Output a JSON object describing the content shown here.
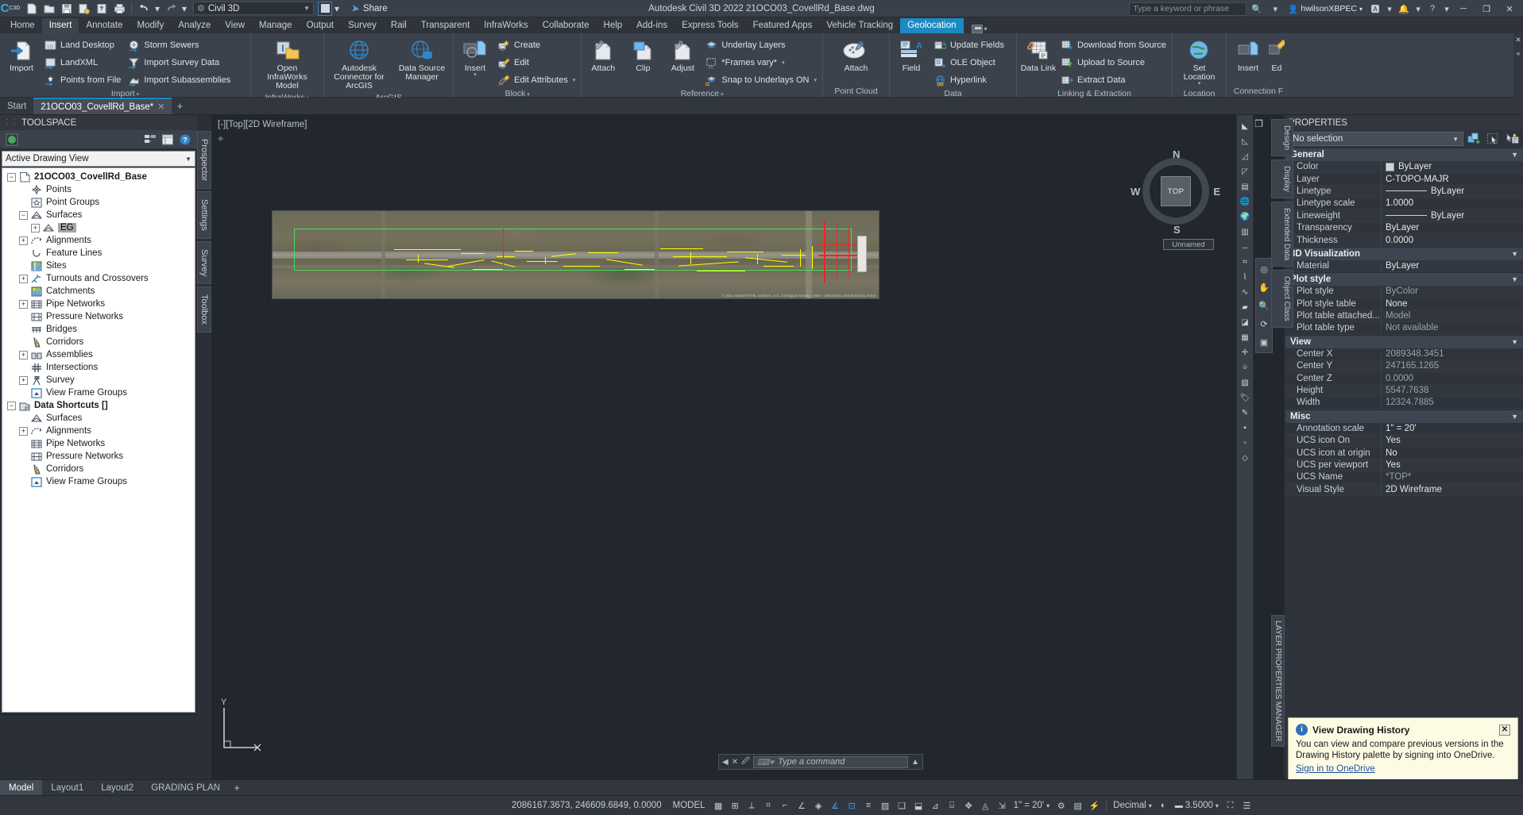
{
  "titlebar": {
    "workspace": "Civil 3D",
    "share_label": "Share",
    "title": "Autodesk Civil 3D 2022    21OCO03_CovellRd_Base.dwg",
    "search_placeholder": "Type a keyword or phrase",
    "user": "hwilsonXBPEC",
    "qat": [
      {
        "name": "new-icon",
        "glyph": "▢"
      },
      {
        "name": "open-icon",
        "glyph": "▱"
      },
      {
        "name": "save-icon",
        "glyph": "▣"
      },
      {
        "name": "saveas-icon",
        "glyph": "▤"
      },
      {
        "name": "cloud-save-icon",
        "glyph": "▥"
      },
      {
        "name": "plot-icon",
        "glyph": "⎙"
      },
      {
        "name": "undo-icon",
        "glyph": "←"
      },
      {
        "name": "redo-icon",
        "glyph": "→"
      }
    ],
    "window_buttons": [
      "─",
      "❐",
      "✕"
    ]
  },
  "ribbon_tabs": [
    {
      "label": "Home",
      "state": ""
    },
    {
      "label": "Insert",
      "state": "active"
    },
    {
      "label": "Annotate",
      "state": ""
    },
    {
      "label": "Modify",
      "state": ""
    },
    {
      "label": "Analyze",
      "state": ""
    },
    {
      "label": "View",
      "state": ""
    },
    {
      "label": "Manage",
      "state": ""
    },
    {
      "label": "Output",
      "state": ""
    },
    {
      "label": "Survey",
      "state": ""
    },
    {
      "label": "Rail",
      "state": ""
    },
    {
      "label": "Transparent",
      "state": ""
    },
    {
      "label": "InfraWorks",
      "state": ""
    },
    {
      "label": "Collaborate",
      "state": ""
    },
    {
      "label": "Help",
      "state": ""
    },
    {
      "label": "Add-ins",
      "state": ""
    },
    {
      "label": "Express Tools",
      "state": ""
    },
    {
      "label": "Featured Apps",
      "state": ""
    },
    {
      "label": "Vehicle Tracking",
      "state": ""
    },
    {
      "label": "Geolocation",
      "state": "hl"
    }
  ],
  "ribbon": {
    "panels": [
      {
        "title": "Import",
        "has_arrow": true,
        "big": [
          {
            "label": "Import",
            "name": "import-button",
            "split": true
          }
        ],
        "small": [
          {
            "label": "Land Desktop",
            "name": "land-desktop-button"
          },
          {
            "label": "LandXML",
            "name": "landxml-button"
          },
          {
            "label": "Points from File",
            "name": "points-from-file-button"
          }
        ],
        "small2": [
          {
            "label": "Storm Sewers",
            "name": "storm-sewers-button"
          },
          {
            "label": "Import Survey Data",
            "name": "import-survey-data-button"
          },
          {
            "label": "Import Subassemblies",
            "name": "import-subassemblies-button"
          }
        ]
      },
      {
        "title": "InfraWorks",
        "has_arrow": true,
        "big": [
          {
            "label": "Open InfraWorks Model",
            "name": "open-infraworks-model-button"
          }
        ]
      },
      {
        "title": "ArcGIS",
        "has_arrow": false,
        "big": [
          {
            "label": "Autodesk Connector for ArcGIS",
            "name": "autodesk-connector-arcgis-button"
          },
          {
            "label": "Data Source Manager",
            "name": "data-source-manager-button"
          }
        ]
      },
      {
        "title": "Block",
        "has_arrow": true,
        "big": [
          {
            "label": "Insert",
            "name": "insert-block-button",
            "split": true
          }
        ],
        "small": [
          {
            "label": "Create",
            "name": "create-block-button"
          },
          {
            "label": "Edit",
            "name": "edit-block-button"
          },
          {
            "label": "Edit Attributes",
            "name": "edit-attributes-button",
            "dropdown": true
          }
        ]
      },
      {
        "title": "Reference",
        "has_arrow": true,
        "big": [
          {
            "label": "Attach",
            "name": "attach-reference-button"
          },
          {
            "label": "Clip",
            "name": "clip-button"
          },
          {
            "label": "Adjust",
            "name": "adjust-button"
          }
        ],
        "small": [
          {
            "label": "Underlay Layers",
            "name": "underlay-layers-button"
          },
          {
            "label": "*Frames vary*",
            "name": "frames-vary-button",
            "dropdown": true
          },
          {
            "label": "Snap to Underlays ON",
            "name": "snap-to-underlays-button",
            "dropdown": true
          }
        ]
      },
      {
        "title": "Point Cloud",
        "has_arrow": false,
        "big": [
          {
            "label": "Attach",
            "name": "attach-point-cloud-button"
          }
        ]
      },
      {
        "title": "Data",
        "has_arrow": false,
        "big": [
          {
            "label": "Field",
            "name": "field-button"
          }
        ],
        "small": [
          {
            "label": "Update Fields",
            "name": "update-fields-button"
          },
          {
            "label": "OLE Object",
            "name": "ole-object-button"
          },
          {
            "label": "Hyperlink",
            "name": "hyperlink-button"
          }
        ]
      },
      {
        "title": "Linking & Extraction",
        "has_arrow": false,
        "big": [
          {
            "label": "Data Link",
            "name": "data-link-button"
          }
        ],
        "small": [
          {
            "label": "Download from Source",
            "name": "download-from-source-button"
          },
          {
            "label": "Upload to Source",
            "name": "upload-to-source-button"
          },
          {
            "label": "Extract  Data",
            "name": "extract-data-button"
          }
        ]
      },
      {
        "title": "Location",
        "has_arrow": false,
        "big": [
          {
            "label": "Set Location",
            "name": "set-location-button",
            "split": true
          }
        ]
      },
      {
        "title": "Connection F",
        "has_arrow": false,
        "big": [
          {
            "label": "Insert",
            "name": "insert-connection-button"
          },
          {
            "label": "Ed",
            "name": "edit-connection-button"
          }
        ]
      }
    ]
  },
  "file_tabs": {
    "start": "Start",
    "documents": [
      {
        "label": "21OCO03_CovellRd_Base*",
        "close": "✕"
      }
    ],
    "add": "+"
  },
  "toolspace": {
    "title": "TOOLSPACE",
    "view_selector": "Active Drawing View",
    "vertical_tabs": [
      "Prospector",
      "Settings",
      "Survey",
      "Toolbox"
    ],
    "tree": [
      {
        "label": "21OCO03_CovellRd_Base",
        "depth": 0,
        "expander": "−",
        "icon": "drawing-icon",
        "bold": true
      },
      {
        "label": "Points",
        "depth": 1,
        "expander": "",
        "icon": "points-icon"
      },
      {
        "label": "Point Groups",
        "depth": 1,
        "expander": "",
        "icon": "point-groups-icon"
      },
      {
        "label": "Surfaces",
        "depth": 1,
        "expander": "−",
        "icon": "surfaces-icon"
      },
      {
        "label": "EG",
        "depth": 2,
        "expander": "+",
        "icon": "surface-icon",
        "selected": true
      },
      {
        "label": "Alignments",
        "depth": 1,
        "expander": "+",
        "icon": "alignments-icon"
      },
      {
        "label": "Feature Lines",
        "depth": 1,
        "expander": "",
        "icon": "feature-lines-icon"
      },
      {
        "label": "Sites",
        "depth": 1,
        "expander": "",
        "icon": "sites-icon"
      },
      {
        "label": "Turnouts and Crossovers",
        "depth": 1,
        "expander": "+",
        "icon": "turnouts-icon"
      },
      {
        "label": "Catchments",
        "depth": 1,
        "expander": "",
        "icon": "catchments-icon"
      },
      {
        "label": "Pipe Networks",
        "depth": 1,
        "expander": "+",
        "icon": "pipe-networks-icon"
      },
      {
        "label": "Pressure Networks",
        "depth": 1,
        "expander": "",
        "icon": "pressure-networks-icon"
      },
      {
        "label": "Bridges",
        "depth": 1,
        "expander": "",
        "icon": "bridges-icon"
      },
      {
        "label": "Corridors",
        "depth": 1,
        "expander": "",
        "icon": "corridors-icon"
      },
      {
        "label": "Assemblies",
        "depth": 1,
        "expander": "+",
        "icon": "assemblies-icon"
      },
      {
        "label": "Intersections",
        "depth": 1,
        "expander": "",
        "icon": "intersections-icon"
      },
      {
        "label": "Survey",
        "depth": 1,
        "expander": "+",
        "icon": "survey-icon"
      },
      {
        "label": "View Frame Groups",
        "depth": 1,
        "expander": "",
        "icon": "view-frame-groups-icon"
      },
      {
        "label": "Data Shortcuts []",
        "depth": 0,
        "expander": "−",
        "icon": "data-shortcuts-icon"
      },
      {
        "label": "Surfaces",
        "depth": 1,
        "expander": "",
        "icon": "surfaces-icon"
      },
      {
        "label": "Alignments",
        "depth": 1,
        "expander": "+",
        "icon": "alignments-icon"
      },
      {
        "label": "Pipe Networks",
        "depth": 1,
        "expander": "",
        "icon": "pipe-networks-icon"
      },
      {
        "label": "Pressure Networks",
        "depth": 1,
        "expander": "",
        "icon": "pressure-networks-icon"
      },
      {
        "label": "Corridors",
        "depth": 1,
        "expander": "",
        "icon": "corridors-icon"
      },
      {
        "label": "View Frame Groups",
        "depth": 1,
        "expander": "",
        "icon": "view-frame-groups-icon"
      }
    ]
  },
  "canvas": {
    "viewport_label": "[-][Top][2D Wireframe]",
    "viewcube": {
      "top": "TOP",
      "n": "N",
      "s": "S",
      "e": "E",
      "w": "W"
    },
    "ucs_badge": "Unnamed",
    "photo_credit": "© 2021 Maxar/NTT/B, Sanborn, U.S. Geological Survey, USDA, CNES/2021 Distributed by Airbus",
    "command_placeholder": "Type a command",
    "ucs_axis_y": "Y",
    "window_controls": [
      "─",
      "❐",
      "✕"
    ]
  },
  "properties": {
    "title": "PROPERTIES",
    "selection": "No selection",
    "vertical_tabs": [
      "Design",
      "Display",
      "Extended Data",
      "Object Class"
    ],
    "groups": [
      {
        "name": "General",
        "rows": [
          {
            "key": "Color",
            "value": "ByLayer",
            "swatch": true
          },
          {
            "key": "Layer",
            "value": "C-TOPO-MAJR"
          },
          {
            "key": "Linetype",
            "value": "ByLayer",
            "line": true
          },
          {
            "key": "Linetype scale",
            "value": "1.0000"
          },
          {
            "key": "Lineweight",
            "value": "ByLayer",
            "line": true
          },
          {
            "key": "Transparency",
            "value": "ByLayer"
          },
          {
            "key": "Thickness",
            "value": "0.0000"
          }
        ]
      },
      {
        "name": "3D Visualization",
        "rows": [
          {
            "key": "Material",
            "value": "ByLayer"
          }
        ]
      },
      {
        "name": "Plot style",
        "rows": [
          {
            "key": "Plot style",
            "value": "ByColor",
            "dim": true
          },
          {
            "key": "Plot style table",
            "value": "None"
          },
          {
            "key": "Plot table attached...",
            "value": "Model",
            "dim": true
          },
          {
            "key": "Plot table type",
            "value": "Not available",
            "dim": true
          }
        ]
      },
      {
        "name": "View",
        "rows": [
          {
            "key": "Center X",
            "value": "2089348.3451",
            "dim": true
          },
          {
            "key": "Center Y",
            "value": "247165.1265",
            "dim": true
          },
          {
            "key": "Center Z",
            "value": "0.0000",
            "dim": true
          },
          {
            "key": "Height",
            "value": "5547.7638",
            "dim": true
          },
          {
            "key": "Width",
            "value": "12324.7885",
            "dim": true
          }
        ]
      },
      {
        "name": "Misc",
        "rows": [
          {
            "key": "Annotation scale",
            "value": "1\" = 20'"
          },
          {
            "key": "UCS icon On",
            "value": "Yes"
          },
          {
            "key": "UCS icon at origin",
            "value": "No"
          },
          {
            "key": "UCS per viewport",
            "value": "Yes"
          },
          {
            "key": "UCS Name",
            "value": "*TOP*",
            "dim": true
          },
          {
            "key": "Visual Style",
            "value": "2D Wireframe"
          }
        ]
      }
    ],
    "side_label": "LAYER PROPERTIES MANAGER"
  },
  "notification": {
    "title": "View Drawing History",
    "body": "You can view and compare previous versions in the Drawing History palette by signing into OneDrive.",
    "link": "Sign in to OneDrive",
    "close": "✕"
  },
  "layout_tabs": {
    "tabs": [
      {
        "label": "Model",
        "sel": true
      },
      {
        "label": "Layout1",
        "sel": false
      },
      {
        "label": "Layout2",
        "sel": false
      },
      {
        "label": "GRADING PLAN",
        "sel": false
      }
    ],
    "add": "+"
  },
  "statusbar": {
    "coordinates": "2086167.3673, 246609.6849, 0.0000",
    "model_label": "MODEL",
    "annotation_scale": "1\" = 20'",
    "decimal_label": "Decimal",
    "lineweight_value": "3.5000"
  }
}
